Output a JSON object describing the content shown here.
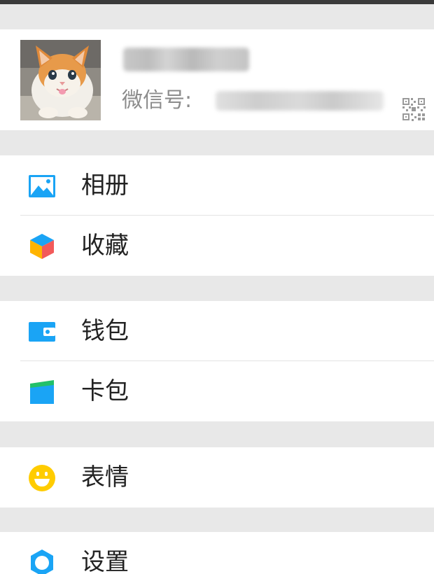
{
  "profile": {
    "wechat_id_label": "微信号:"
  },
  "menu": {
    "album": "相册",
    "favorites": "收藏",
    "wallet": "钱包",
    "card_bag": "卡包",
    "stickers": "表情",
    "settings": "设置"
  },
  "colors": {
    "section_gap": "#e8e8e8",
    "row_background": "#ffffff",
    "icon_blue": "#1aa4f5",
    "icon_yellow": "#ffcc00"
  },
  "icons": [
    "qr-code-icon",
    "album-icon",
    "favorites-icon",
    "wallet-icon",
    "card-bag-icon",
    "stickers-icon",
    "settings-icon"
  ]
}
